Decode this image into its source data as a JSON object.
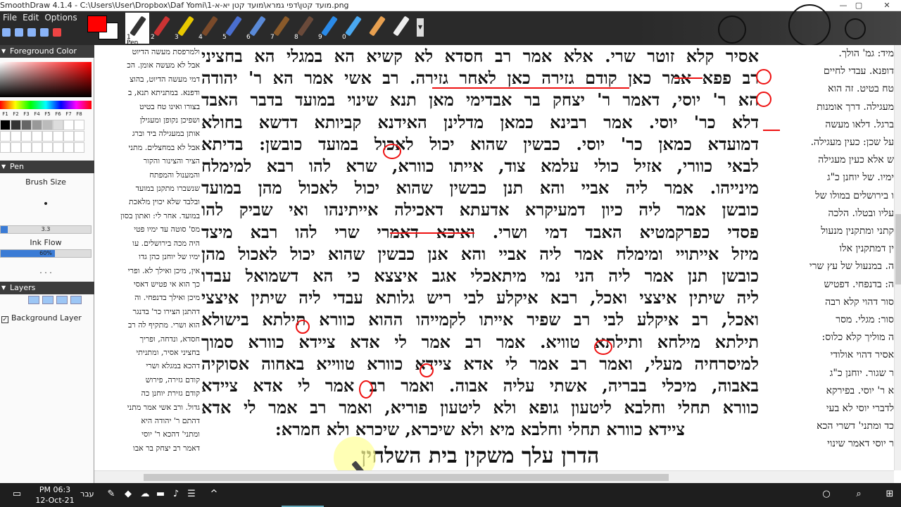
{
  "window": {
    "title": "SmoothDraw 4.1.4 - C:\\Users\\User\\Dropbox\\Daf Yomi\\1-מועד קטן\\דפי גמרא\\מועד קטן יא-א.png",
    "min": "—",
    "max": "▢",
    "close": "✕"
  },
  "menu": [
    "File",
    "Edit",
    "Options"
  ],
  "tools": [
    {
      "num": "1",
      "label": "Pen",
      "color": "#333333"
    },
    {
      "num": "2",
      "label": "",
      "color": "#cc3333"
    },
    {
      "num": "3",
      "label": "",
      "color": "#e8c800"
    },
    {
      "num": "4",
      "label": "",
      "color": "#7a4a2a"
    },
    {
      "num": "5",
      "label": "",
      "color": "#4a6fd0"
    },
    {
      "num": "6",
      "label": "",
      "color": "#5a8ad8"
    },
    {
      "num": "7",
      "label": "",
      "color": "#8a5a2a"
    },
    {
      "num": "8",
      "label": "",
      "color": "#6a4a3a"
    },
    {
      "num": "9",
      "label": "",
      "color": "#2a8ae8"
    },
    {
      "num": "0",
      "label": "",
      "color": "#4aa8f0"
    },
    {
      "num": "",
      "label": "",
      "color": "#e8a050"
    },
    {
      "num": "",
      "label": "",
      "color": "#eeeeee"
    }
  ],
  "colors": {
    "foreground": "#ff0000",
    "background": "#ffffff",
    "accent": "#e11111"
  },
  "panels": {
    "foreground": "Foreground Color",
    "fkeys": [
      "F1",
      "F2",
      "F3",
      "F4",
      "F5",
      "F6",
      "F7",
      "F8"
    ],
    "pen": "Pen",
    "brush_size_label": "Brush Size",
    "brush_size_value": "3.3",
    "brush_size_fraction": 0.08,
    "ink_flow_label": "Ink Flow",
    "ink_flow_value": "60%",
    "ink_flow_fraction": 0.6,
    "more": ". . .",
    "layers": "Layers",
    "background_layer": "Background Layer"
  },
  "swatches": [
    "#000000",
    "#333333",
    "#666666",
    "#999999",
    "#bbbbbb",
    "#dddddd",
    "#ffffff",
    "#ffffff"
  ],
  "page": {
    "left_column": [
      "ולמרפסת מעשה הדיוט",
      "אבל לא מעשה אומן. הכ",
      "דמי מעשה הדיוט, בהוצ",
      "ודפנא. במתניתא תנא, ב",
      "בצורו ואינו טח בטיט",
      "ושפיכן נקופן ומעגילן",
      "אותן במעגילה ביד וברג",
      "אבל לא במחצלים. מתני",
      "הציר והצינור והקור",
      "והמענול והמפתח",
      "שנשברו מתקנן במועד",
      "ובלבד שלא יכוין מלאכת",
      "במועד. אחר לי: ואתון בסון",
      "מס' סוטה עד ימיו פטי",
      "היה מכה בירושלים. עו",
      "ימיו של יוחנן כהן גדו",
      "אין, מיכן ואילך לא. ופרי",
      "כך הוא אי פטיש דאסי",
      "מיכן ואילך בדנפחי. וה",
      "דהתנן הצירו כר' בדנגר",
      "הוא ושרי. מתקיף לה רב",
      "חסדא, ונדחה, ופריך",
      "בחציני אסיר, ומתניתי",
      "דהכא במגלא ושרי",
      "קודם גזירה, פירוש",
      "קודם גזירת יוחנן כה",
      "גדול. ורב אשי אמר מתני",
      "דהתם ר' יהודה היא",
      "ומתני' דהכא ר' יוסי",
      "דאמר רב יצחק בר אבו"
    ],
    "main_lines": [
      "אסיר קלא זוטר שרי. אלא אמר רב חסדא לא קשיא הא במגלי הא בחציני",
      "רב פפא אמר כאן קודם גזירה כאן לאחר גזירה. רב אשי אמר הא ר' יהודה",
      "הא ר' יוסי, דאמר ר' יצחק בר אבדימי מאן תנא שינוי במועד בדבר האבד",
      "דלא כר' יוסי. אמר רבינא כמאן מדלינן האידנא קביותא דדשא בחולא",
      "דמועדא כמאן כר' יוסי. כבשין שהוא יכול לאכול במועד כובשן: בדיתא",
      "לבאי כוורי, אזיל כולי עלמא צוד, אייתו כוורא, שרא להו רבא למימלח",
      "מינייהו. אמר ליה אביי והא תנן כבשין שהוא יכול לאכול מהן במועד",
      "כובשן אמר ליה כיון דמעיקרא אדעתא דאכילה אייתינהו ואי שביק להו",
      "פסדי כפרקמטיא האבד דמי ושרי. ואיכא דאמרי שרי להו רבא מיצד",
      "מיזל אייתויי ומימלח אמר ליה אביי והא אנן כבשין שהוא יכול לאכול מהן",
      "כובשן תנן אמר ליה הני נמי מיתאכלי אגב איצצא כי הא דשמואל עבדו",
      "ליה שיתין איצצי ואכל, רבא איקלע לבי ריש גלותא עבדי ליה שיתין איצצי",
      "ואכל, רב איקלע לבי רב שפיר אייתו לקמייהו ההוא כוורא תילתא בישולא",
      "תילתא מילחא ותילתא טוויא. אמר רב אמר לי אדא ציידא כוורא סמוך",
      "למיסרחיה מעלי, ואמר רב אמר לי אדא ציידא כוורא טווייא באחוה אסוקיה",
      "באבוה, מיכלי בבריה, אשתי עליה אבוה. ואמר רב אמר לי אדא ציידא",
      "כוורא תחלי וחלבא ליטעון גופא ולא ליטעון פוריא, ואמר רב אמר לי אדא",
      "ציידא כוורא תחלי וחלבא מיא ולא שיכרא, שיכרא ולא חמרא:"
    ],
    "heading": "הדרן עלך משקין בית השלחין",
    "right_column": [
      "מיד: גמ' הולך.",
      "דופנא. עבדי לחיים",
      "טח בטיט. זה הוא",
      "מעגילה. דרך אומנות",
      "ברגל. דלאו מעשה",
      "על שכן: כעין מעגילה.",
      "ש אלא כעין מעגילה",
      "ימיו. של יוחנן כ\"ג",
      "ו בירושלים במולו של",
      "עליו ובטלו. הלכה",
      "קתני ומתקנין מנעול",
      "ין דמתקנין אלו",
      "ה. במנעול של עץ שרי",
      "ה: בדנפחי. דפטיש",
      "סור דהוי קלא רבה",
      "סור: מגלי. מסר",
      "ה מוליך קלא כלוס:",
      "אסיר דהוי אולודי",
      "ר שגור. יוחנן כ\"ג",
      "א ר' יוסי. בפירקא",
      "לדברי יוסי לא בעי",
      "כד ומתני' דשרי הכא",
      "ר יוסי דאמר שינוי"
    ]
  },
  "taskbar": {
    "time": "PM 06:3",
    "date": "12-Oct-21",
    "lang": "עבר"
  }
}
